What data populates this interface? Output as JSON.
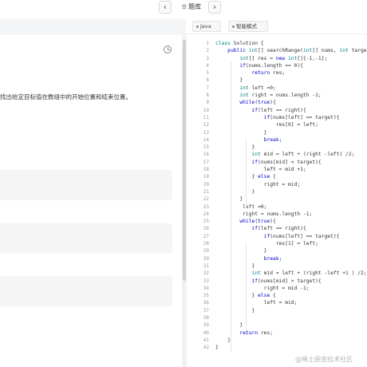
{
  "nav": {
    "prev_icon": "‹",
    "next_icon": "›",
    "list_icon": "☰",
    "title": "题库"
  },
  "toolbar": {
    "language": "Java",
    "smart_mode": "智能模式"
  },
  "problem": {
    "description_fragment": "找出给定目标值在数组中的开始位置和结束位置。"
  },
  "editor": {
    "line_numbers": [
      "1",
      "2",
      "3",
      "4",
      "5",
      "6",
      "7",
      "8",
      "9",
      "10",
      "11",
      "12",
      "13",
      "14",
      "15",
      "16",
      "17",
      "18",
      "19",
      "20",
      "21",
      "22",
      "23",
      "24",
      "25",
      "26",
      "27",
      "28",
      "29",
      "30",
      "31",
      "32",
      "33",
      "34",
      "35",
      "36",
      "37",
      "38",
      "39",
      "40",
      "41",
      "42"
    ],
    "lines": [
      "class Solution {",
      "    public int[] searchRange(int[] nums, int target) {",
      "        int[] res = new int[]{-1,-1};",
      "        if(nums.length == 0){",
      "            return res;",
      "        }",
      "        int left =0;",
      "        int right = nums.length -1;",
      "        while(true){",
      "            if(left == right){",
      "                if(nums[left] == target){",
      "                    res[0] = left;",
      "                }",
      "                break;",
      "            }",
      "            int mid = left + (right -left) /2;",
      "            if(nums[mid] < target){",
      "                left = mid +1;",
      "            } else {",
      "                right = mid;",
      "            }",
      "        }",
      "         left =0;",
      "         right = nums.length -1;",
      "        while(true){",
      "            if(left == right){",
      "                if(nums[left] == target){",
      "                    res[1] = left;",
      "                }",
      "                break;",
      "            }",
      "            int mid = left + (right -left +1 ) /2;",
      "            if(nums[mid] > target){",
      "                right = mid -1;",
      "            } else {",
      "                left = mid;",
      "            }",
      "",
      "        }",
      "        return res;",
      "    }",
      "}"
    ]
  },
  "watermark": "@稀土掘金技术社区"
}
